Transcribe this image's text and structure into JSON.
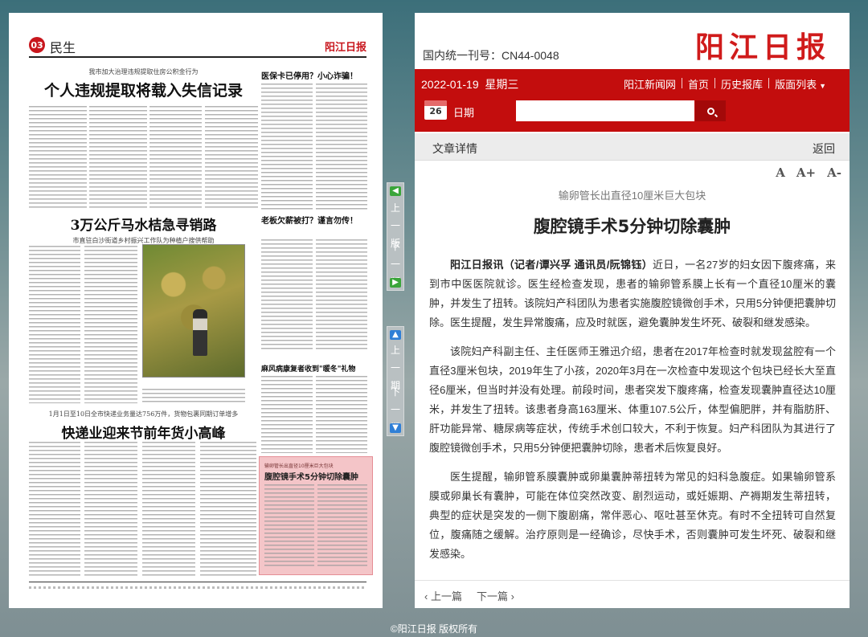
{
  "paper": {
    "page_number": "03",
    "page_name": "民生",
    "logo": "阳江日报",
    "stories": [
      {
        "kicker": "我市加大治理违规提取住房公积金行为",
        "headline": "个人违规提取将载入失信记录"
      },
      {
        "kicker": "",
        "headline": "医保卡已停用？小心诈骗！"
      },
      {
        "kicker": "",
        "headline": "3万公斤马水桔急寻销路"
      },
      {
        "kicker": "市直驻白沙街道乡村振兴工作队为种植户搜供帮助",
        "headline": ""
      },
      {
        "kicker": "",
        "headline": "老板欠薪被打？谨言勿传！"
      },
      {
        "kicker": "",
        "headline": "麻风病康复者收到\"暖冬\"礼物"
      },
      {
        "kicker": "1月1日至10日全市快递业务量达756万件，货物包裹同期订单增多",
        "headline": "快递业迎来节前年货小高峰"
      },
      {
        "kicker": "输卵管长出直径10厘米巨大包块",
        "headline": "腹腔镜手术5分钟切除囊肿"
      }
    ]
  },
  "page_nav": {
    "prev_page": "上一版",
    "next_page": "下一版",
    "prev_issue": "上一期",
    "next_issue": "下一期"
  },
  "header": {
    "issn": "国内统一刊号：CN44-0048",
    "logo": "阳江日报",
    "date": "2022-01-19",
    "weekday": "星期三",
    "links": [
      "阳江新闻网",
      "首页",
      "历史报库",
      "版面列表"
    ],
    "calendar_day": "26",
    "calendar_label": "日期",
    "search_placeholder": ""
  },
  "detail": {
    "title": "文章详情",
    "back": "返回",
    "font_normal": "A",
    "font_larger": "A+",
    "font_smaller": "A-"
  },
  "article": {
    "subtitle": "输卵管长出直径10厘米巨大包块",
    "title": "腹腔镜手术5分钟切除囊肿",
    "lead_bold": "阳江日报讯（记者/谭兴孚 通讯员/阮锦钰）",
    "p1": "近日，一名27岁的妇女因下腹疼痛，来到市中医医院就诊。医生经检查发现，患者的输卵管系膜上长有一个直径10厘米的囊肿，并发生了扭转。该院妇产科团队为患者实施腹腔镜微创手术，只用5分钟便把囊肿切除。医生提醒，发生异常腹痛，应及时就医，避免囊肿发生坏死、破裂和继发感染。",
    "p2": "该院妇产科副主任、主任医师王雅迅介绍，患者在2017年检查时就发现盆腔有一个直径3厘米包块，2019年生了小孩，2020年3月在一次检查中发现这个包块已经长大至直径6厘米，但当时并没有处理。前段时间，患者突发下腹疼痛，检查发现囊肿直径达10厘米，并发生了扭转。该患者身高163厘米、体重107.5公斤，体型偏肥胖，并有脂肪肝、肝功能异常、糖尿病等症状，传统手术创口较大，不利于恢复。妇产科团队为其进行了腹腔镜微创手术，只用5分钟便把囊肿切除，患者术后恢复良好。",
    "p3": "医生提醒，输卵管系膜囊肿或卵巢囊肿蒂扭转为常见的妇科急腹症。如果输卵管系膜或卵巢长有囊肿，可能在体位突然改变、剧烈运动，或妊娠期、产褥期发生蒂扭转，典型的症状是突发的一侧下腹剧痛，常伴恶心、呕吐甚至休克。有时不全扭转可自然复位，腹痛随之缓解。治疗原则是一经确诊，尽快手术，否则囊肿可发生坏死、破裂和继发感染。"
  },
  "pager": {
    "prev": "‹ 上一篇",
    "next": "下一篇 ›"
  },
  "footer": {
    "copyright": "©阳江日报 版权所有"
  },
  "colors": {
    "brand_red": "#c30d0d",
    "highlight_pink": "#f4c5c8"
  }
}
